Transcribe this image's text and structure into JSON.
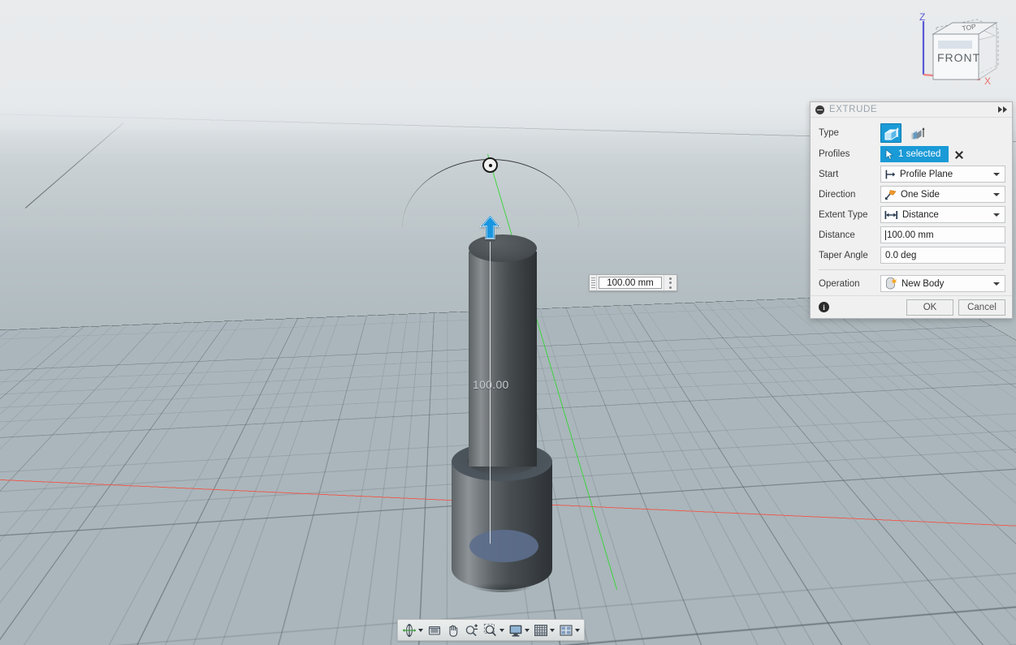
{
  "app": {
    "viewport_name": "3d-modeling-viewport",
    "accent_blue": "#1a9ad7",
    "axis_x_color": "#f0564a",
    "axis_y_color": "#35d435",
    "axis_z_color": "#5a5ad4"
  },
  "viewcube": {
    "top_face_label": "TOP",
    "front_face_label": "FRONT",
    "axis_labels": {
      "z": "Z",
      "x": "X"
    }
  },
  "model": {
    "dimension_overlay": "100.00",
    "manipulator_icon": "up-arrow-handle-icon",
    "origin_marker_icon": "sketch-origin-icon"
  },
  "float_input": {
    "value": "100.00 mm",
    "placeholder": "100.00 mm",
    "grip_icon": "drag-grip-icon",
    "menu_icon": "more-options-icon"
  },
  "nav_toolbar": {
    "buttons": [
      {
        "name": "orbit-button",
        "icon": "orbit-icon",
        "has_caret": true
      },
      {
        "name": "look-at-button",
        "icon": "look-at-icon",
        "has_caret": false
      },
      {
        "name": "pan-button",
        "icon": "pan-hand-icon",
        "has_caret": false
      },
      {
        "name": "zoom-button",
        "icon": "zoom-plus-minus-icon",
        "has_caret": false
      },
      {
        "name": "zoom-window-button",
        "icon": "zoom-window-icon",
        "has_caret": true
      },
      {
        "name": "display-settings-button",
        "icon": "monitor-icon",
        "has_caret": true
      },
      {
        "name": "grid-snaps-button",
        "icon": "grid-icon",
        "has_caret": true
      },
      {
        "name": "viewports-button",
        "icon": "viewports-icon",
        "has_caret": true
      }
    ]
  },
  "extrude_dialog": {
    "title": "EXTRUDE",
    "collapse_icon": "collapse-circle-icon",
    "expand_icon": "expand-double-chevron-icon",
    "rows": {
      "type": {
        "label": "Type",
        "options": [
          {
            "name": "type-solid-button",
            "icon": "extrude-solid-icon",
            "selected": true
          },
          {
            "name": "type-thin-button",
            "icon": "extrude-thin-icon",
            "selected": false
          }
        ]
      },
      "profiles": {
        "label": "Profiles",
        "value": "1 selected",
        "select_icon": "cursor-arrow-icon",
        "clear_icon": "clear-x-icon"
      },
      "start": {
        "label": "Start",
        "value": "Profile Plane",
        "icon": "profile-plane-icon"
      },
      "direction": {
        "label": "Direction",
        "value": "One Side",
        "icon": "one-side-flag-icon"
      },
      "extent_type": {
        "label": "Extent Type",
        "value": "Distance",
        "icon": "distance-arrows-icon"
      },
      "distance": {
        "label": "Distance",
        "value": "100.00 mm",
        "placeholder": "100.00 mm"
      },
      "taper_angle": {
        "label": "Taper Angle",
        "value": "0.0 deg",
        "placeholder": "0.0 deg"
      },
      "operation": {
        "label": "Operation",
        "value": "New Body",
        "icon": "new-body-icon"
      }
    },
    "footer": {
      "info_icon": "info-icon",
      "info_glyph": "i",
      "ok_label": "OK",
      "cancel_label": "Cancel"
    }
  }
}
